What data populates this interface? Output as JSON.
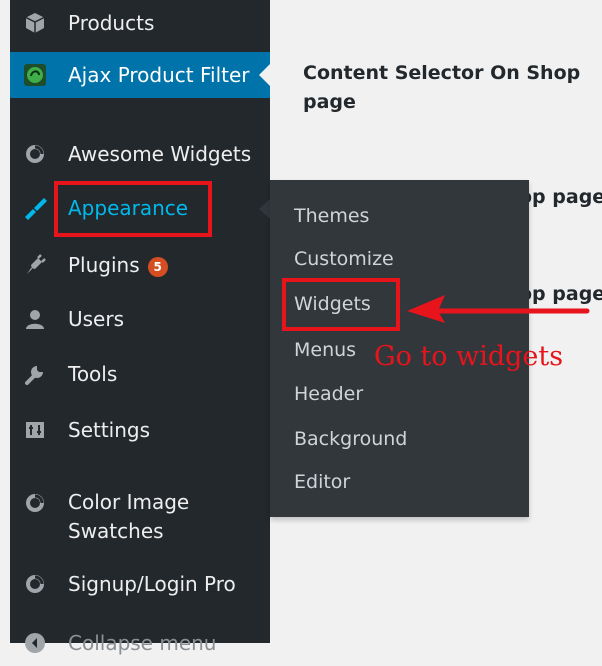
{
  "sidebar": {
    "items": [
      {
        "label": "Products",
        "icon": "cube-icon"
      },
      {
        "label": "Ajax Product Filter",
        "icon": "filter-logo-icon"
      },
      {
        "label": "Awesome Widgets",
        "icon": "plugin-circle-icon"
      },
      {
        "label": "Appearance",
        "icon": "paintbrush-icon"
      },
      {
        "label": "Plugins",
        "icon": "plug-icon",
        "badge": "5"
      },
      {
        "label": "Users",
        "icon": "user-icon"
      },
      {
        "label": "Tools",
        "icon": "wrench-icon"
      },
      {
        "label": "Settings",
        "icon": "settings-icon"
      },
      {
        "label": "Color Image",
        "label2": "Swatches",
        "icon": "plugin-circle-icon"
      },
      {
        "label": "Signup/Login Pro",
        "icon": "plugin-circle-icon"
      },
      {
        "label": "Collapse menu",
        "icon": "collapse-icon"
      }
    ]
  },
  "flyout": {
    "items": [
      "Themes",
      "Customize",
      "Widgets",
      "Menus",
      "Header",
      "Background",
      "Editor"
    ]
  },
  "content": {
    "heading_line1": "Content Selector On Shop",
    "heading_line2": "page",
    "partial_1": "op page",
    "partial_2": "op page"
  },
  "annotation": {
    "text": "Go to widgets"
  },
  "colors": {
    "sidebar_bg": "#23282d",
    "active_bg": "#0073aa",
    "flyout_bg": "#32373c",
    "highlight_red": "#e8141b",
    "current_text": "#00b9eb"
  }
}
